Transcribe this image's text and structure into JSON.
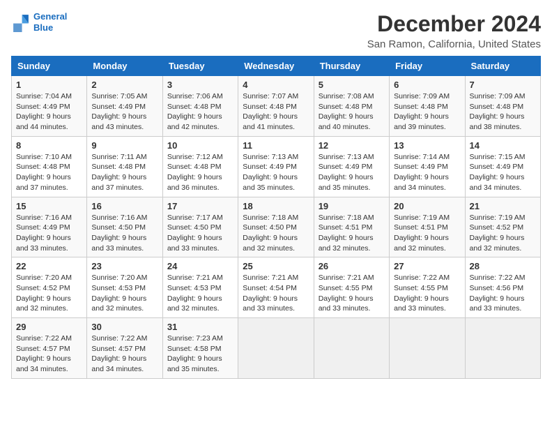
{
  "logo": {
    "line1": "General",
    "line2": "Blue",
    "icon_color": "#1a6dbf"
  },
  "title": "December 2024",
  "subtitle": "San Ramon, California, United States",
  "calendar": {
    "headers": [
      "Sunday",
      "Monday",
      "Tuesday",
      "Wednesday",
      "Thursday",
      "Friday",
      "Saturday"
    ],
    "weeks": [
      [
        {
          "day": "1",
          "sunrise": "7:04 AM",
          "sunset": "4:49 PM",
          "daylight": "9 hours and 44 minutes."
        },
        {
          "day": "2",
          "sunrise": "7:05 AM",
          "sunset": "4:49 PM",
          "daylight": "9 hours and 43 minutes."
        },
        {
          "day": "3",
          "sunrise": "7:06 AM",
          "sunset": "4:48 PM",
          "daylight": "9 hours and 42 minutes."
        },
        {
          "day": "4",
          "sunrise": "7:07 AM",
          "sunset": "4:48 PM",
          "daylight": "9 hours and 41 minutes."
        },
        {
          "day": "5",
          "sunrise": "7:08 AM",
          "sunset": "4:48 PM",
          "daylight": "9 hours and 40 minutes."
        },
        {
          "day": "6",
          "sunrise": "7:09 AM",
          "sunset": "4:48 PM",
          "daylight": "9 hours and 39 minutes."
        },
        {
          "day": "7",
          "sunrise": "7:09 AM",
          "sunset": "4:48 PM",
          "daylight": "9 hours and 38 minutes."
        }
      ],
      [
        {
          "day": "8",
          "sunrise": "7:10 AM",
          "sunset": "4:48 PM",
          "daylight": "9 hours and 37 minutes."
        },
        {
          "day": "9",
          "sunrise": "7:11 AM",
          "sunset": "4:48 PM",
          "daylight": "9 hours and 37 minutes."
        },
        {
          "day": "10",
          "sunrise": "7:12 AM",
          "sunset": "4:48 PM",
          "daylight": "9 hours and 36 minutes."
        },
        {
          "day": "11",
          "sunrise": "7:13 AM",
          "sunset": "4:49 PM",
          "daylight": "9 hours and 35 minutes."
        },
        {
          "day": "12",
          "sunrise": "7:13 AM",
          "sunset": "4:49 PM",
          "daylight": "9 hours and 35 minutes."
        },
        {
          "day": "13",
          "sunrise": "7:14 AM",
          "sunset": "4:49 PM",
          "daylight": "9 hours and 34 minutes."
        },
        {
          "day": "14",
          "sunrise": "7:15 AM",
          "sunset": "4:49 PM",
          "daylight": "9 hours and 34 minutes."
        }
      ],
      [
        {
          "day": "15",
          "sunrise": "7:16 AM",
          "sunset": "4:49 PM",
          "daylight": "9 hours and 33 minutes."
        },
        {
          "day": "16",
          "sunrise": "7:16 AM",
          "sunset": "4:50 PM",
          "daylight": "9 hours and 33 minutes."
        },
        {
          "day": "17",
          "sunrise": "7:17 AM",
          "sunset": "4:50 PM",
          "daylight": "9 hours and 33 minutes."
        },
        {
          "day": "18",
          "sunrise": "7:18 AM",
          "sunset": "4:50 PM",
          "daylight": "9 hours and 32 minutes."
        },
        {
          "day": "19",
          "sunrise": "7:18 AM",
          "sunset": "4:51 PM",
          "daylight": "9 hours and 32 minutes."
        },
        {
          "day": "20",
          "sunrise": "7:19 AM",
          "sunset": "4:51 PM",
          "daylight": "9 hours and 32 minutes."
        },
        {
          "day": "21",
          "sunrise": "7:19 AM",
          "sunset": "4:52 PM",
          "daylight": "9 hours and 32 minutes."
        }
      ],
      [
        {
          "day": "22",
          "sunrise": "7:20 AM",
          "sunset": "4:52 PM",
          "daylight": "9 hours and 32 minutes."
        },
        {
          "day": "23",
          "sunrise": "7:20 AM",
          "sunset": "4:53 PM",
          "daylight": "9 hours and 32 minutes."
        },
        {
          "day": "24",
          "sunrise": "7:21 AM",
          "sunset": "4:53 PM",
          "daylight": "9 hours and 32 minutes."
        },
        {
          "day": "25",
          "sunrise": "7:21 AM",
          "sunset": "4:54 PM",
          "daylight": "9 hours and 33 minutes."
        },
        {
          "day": "26",
          "sunrise": "7:21 AM",
          "sunset": "4:55 PM",
          "daylight": "9 hours and 33 minutes."
        },
        {
          "day": "27",
          "sunrise": "7:22 AM",
          "sunset": "4:55 PM",
          "daylight": "9 hours and 33 minutes."
        },
        {
          "day": "28",
          "sunrise": "7:22 AM",
          "sunset": "4:56 PM",
          "daylight": "9 hours and 33 minutes."
        }
      ],
      [
        {
          "day": "29",
          "sunrise": "7:22 AM",
          "sunset": "4:57 PM",
          "daylight": "9 hours and 34 minutes."
        },
        {
          "day": "30",
          "sunrise": "7:22 AM",
          "sunset": "4:57 PM",
          "daylight": "9 hours and 34 minutes."
        },
        {
          "day": "31",
          "sunrise": "7:23 AM",
          "sunset": "4:58 PM",
          "daylight": "9 hours and 35 minutes."
        },
        null,
        null,
        null,
        null
      ]
    ]
  }
}
